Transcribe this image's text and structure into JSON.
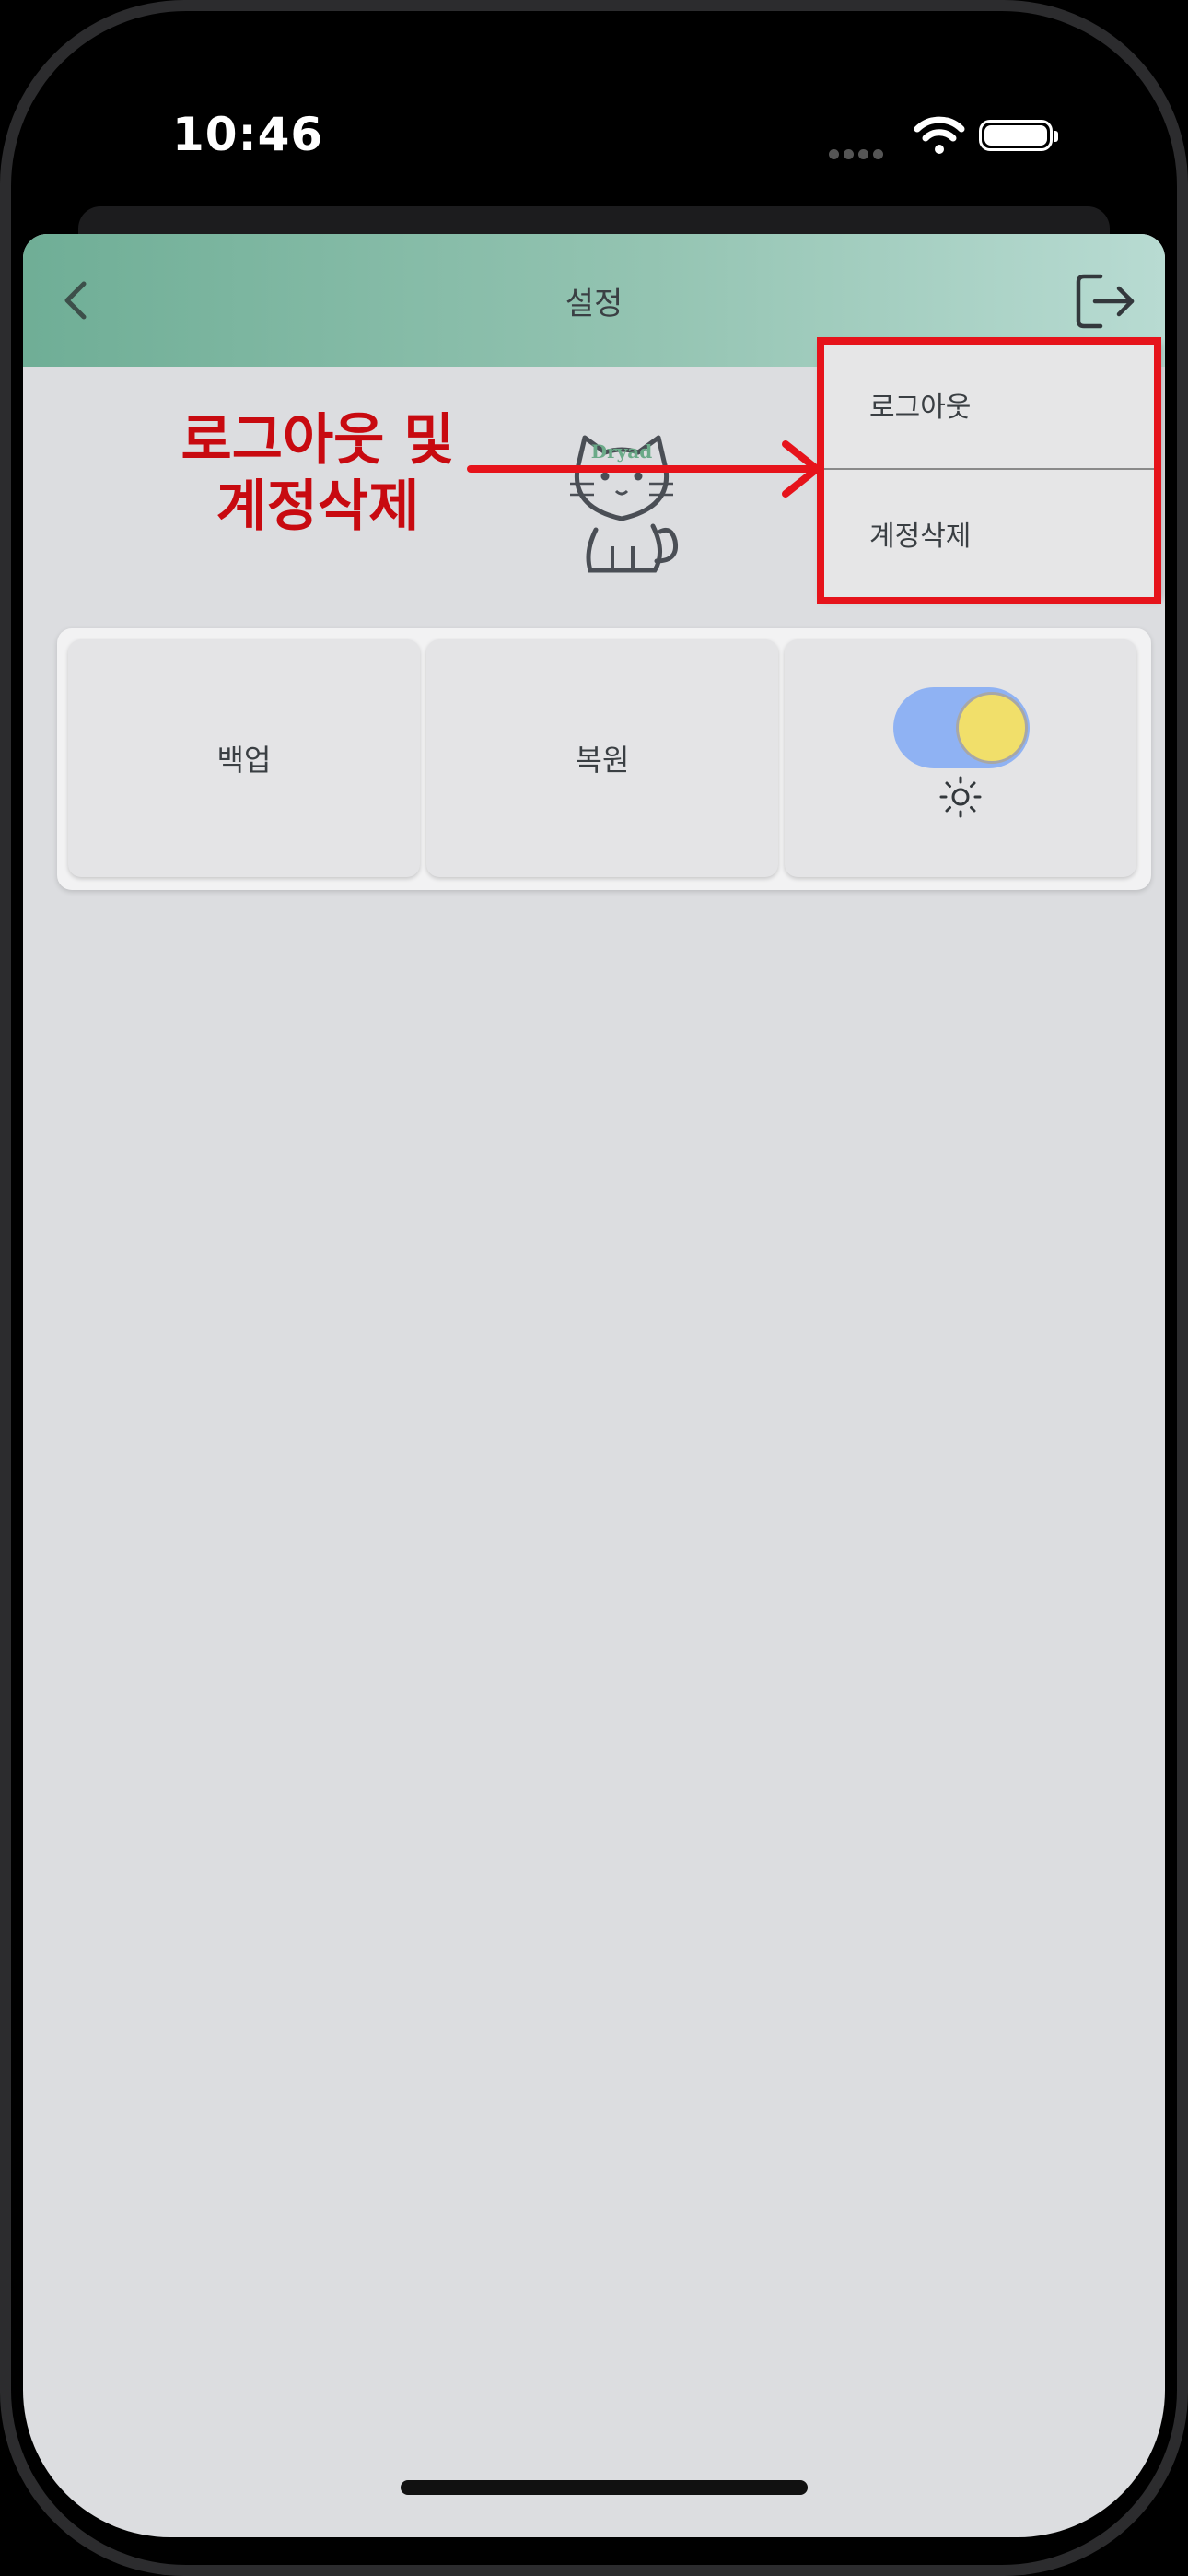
{
  "status_bar": {
    "time": "10:46"
  },
  "appbar": {
    "title": "설정",
    "back_icon": "chevron-left-icon",
    "logout_icon": "logout-icon"
  },
  "avatar": {
    "logo_text": "Dryad"
  },
  "tiles": {
    "backup": "백업",
    "restore": "복원",
    "theme_toggle_on": true
  },
  "menu": {
    "items": [
      {
        "label": "로그아웃"
      },
      {
        "label": "계정삭제"
      }
    ]
  },
  "annotation": {
    "line1": "로그아웃 및",
    "line2": "계정삭제"
  },
  "colors": {
    "appbar_start": "#6fae96",
    "appbar_end": "#b8dbd2",
    "annotation_red": "#e6131b",
    "toggle_track": "#8fb2f3",
    "toggle_knob": "#f1df6a",
    "screen_bg": "#dcdde0"
  }
}
